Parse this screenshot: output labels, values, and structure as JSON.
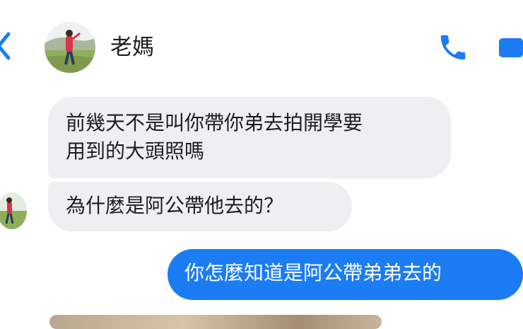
{
  "header": {
    "contact_name": "老媽",
    "back_icon": "chevron-left-icon",
    "call_icon": "phone-icon",
    "video_icon": "video-camera-icon",
    "accent_color": "#1b7cf3"
  },
  "messages": [
    {
      "direction": "incoming",
      "text_line1": "前幾天不是叫你帶你弟去拍開學要",
      "text_line2": "用到的大頭照嗎"
    },
    {
      "direction": "incoming",
      "text": "為什麼是阿公帶他去的？"
    },
    {
      "direction": "outgoing",
      "text": "你怎麼知道是阿公帶弟弟去的"
    }
  ],
  "colors": {
    "incoming_bubble": "#efeff1",
    "outgoing_bubble": "#1b7cf3",
    "text": "#1c1e21"
  }
}
